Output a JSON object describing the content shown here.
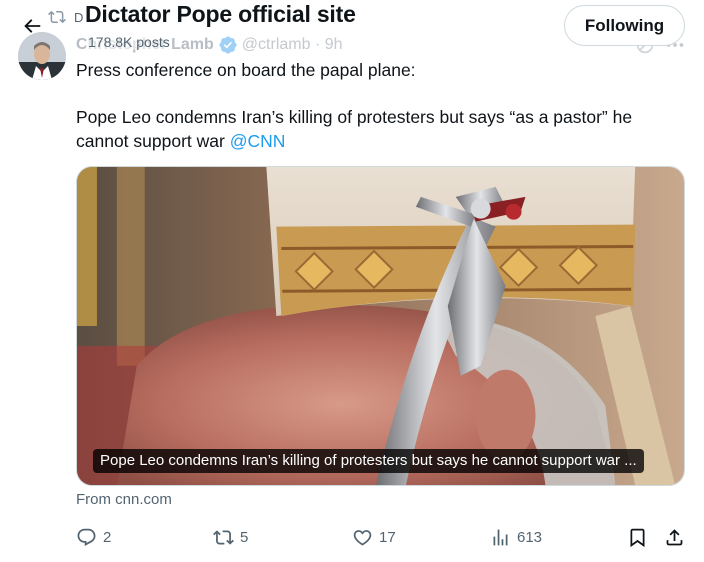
{
  "top_bar": {
    "title": "Dictator Pope official site",
    "post_count": "178.8K posts",
    "follow_label": "Following"
  },
  "retweet": {
    "label": "D"
  },
  "tweet": {
    "author_name": "Christopher Lamb",
    "handle_time": "@ctrlamb · 9h",
    "text_line1": "Press conference on board the papal plane:",
    "text_line2": "Pope Leo condemns Iran’s killing of protesters but says “as a pastor” he cannot support war ",
    "mention": "@CNN"
  },
  "card": {
    "caption": "Pope Leo condemns Iran’s killing of protesters but says he cannot support war ...",
    "source": "From cnn.com"
  },
  "actions": {
    "replies": "2",
    "reposts": "5",
    "likes": "17",
    "views": "613"
  },
  "colors": {
    "accent": "#1d9bf0",
    "text": "#0f1419",
    "muted": "#536471",
    "border": "#cfd9de"
  }
}
